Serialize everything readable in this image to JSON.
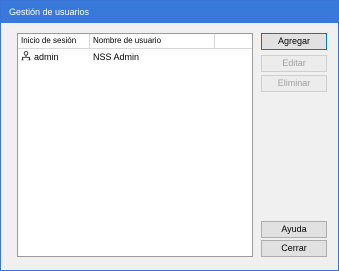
{
  "window": {
    "title": "Gestión de usuarios"
  },
  "table": {
    "columns": [
      "Inicio de sesión",
      "Nombre de usuario",
      ""
    ],
    "rows": [
      {
        "icon": "user-group-icon",
        "login": "admin",
        "name": "NSS Admin"
      }
    ]
  },
  "buttons": {
    "add": "Agregar",
    "edit": "Editar",
    "delete": "Eliminar",
    "help": "Ayuda",
    "close": "Cerrar"
  },
  "colors": {
    "titlebar": "#3879d9",
    "accent": "#0078d7"
  }
}
